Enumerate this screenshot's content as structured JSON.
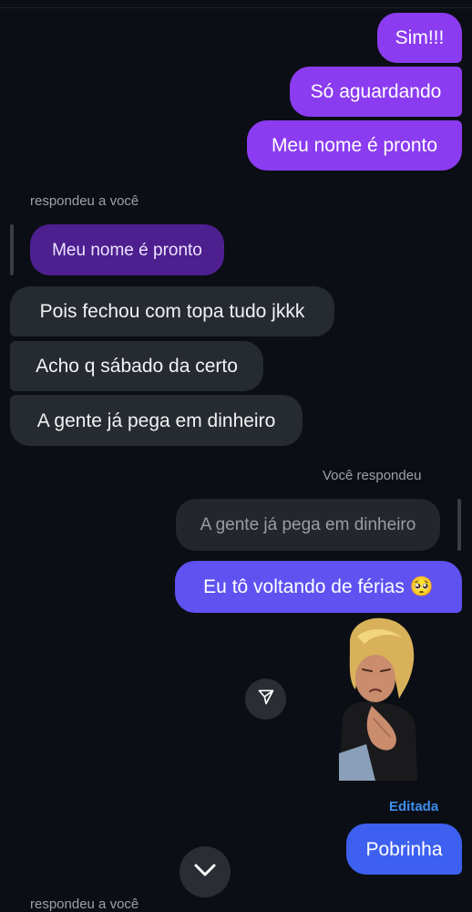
{
  "messages": {
    "sim": "Sim!!!",
    "so_aguardando": "Só aguardando",
    "meu_nome_pronto": "Meu nome é pronto",
    "reply_label_1": "respondeu a você",
    "quoted_reply_1": "Meu nome é pronto",
    "pois_fechou": "Pois fechou com topa tudo jkkk",
    "acho_sabado": "Acho q sábado da certo",
    "a_gente_pega": "A gente já pega em dinheiro",
    "voce_respondeu_label": "Você respondeu",
    "quoted_reply_2": "A gente já pega em dinheiro",
    "voltando_ferias": "Eu tô voltando de férias 🥺",
    "edited_label": "Editada",
    "pobrinha": "Pobrinha",
    "reply_label_2": "respondeu a você"
  },
  "icons": {
    "share": "paper-plane-icon",
    "scroll_down": "chevron-down-icon",
    "sticker": "sticker-image"
  },
  "colors": {
    "background": "#0b0e14",
    "sent_purple": "#8b3cf0",
    "sent_indigo": "#5f52f0",
    "sent_blue": "#3d60f0",
    "received": "#262a31",
    "edited_accent": "#3d8ff0"
  }
}
